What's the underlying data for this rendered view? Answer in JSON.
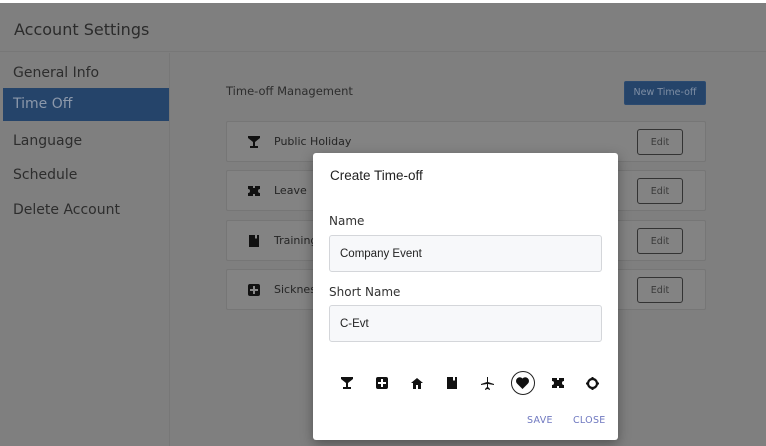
{
  "header": {
    "title": "Account Settings"
  },
  "sidebar": {
    "items": [
      {
        "label": "General Info"
      },
      {
        "label": "Time Off",
        "active": true
      },
      {
        "label": "Language"
      },
      {
        "label": "Schedule"
      },
      {
        "label": "Delete Account"
      }
    ]
  },
  "main": {
    "title": "Time-off Management",
    "new_button": "New Time-off",
    "edit_label": "Edit",
    "rows": [
      {
        "label": "Public Holiday",
        "icon": "cocktail-icon"
      },
      {
        "label": "Leave",
        "icon": "ticket-icon"
      },
      {
        "label": "Training",
        "icon": "book-icon"
      },
      {
        "label": "Sickness",
        "icon": "medical-plus-icon"
      }
    ]
  },
  "modal": {
    "title": "Create Time-off",
    "name_label": "Name",
    "name_value": "Company Event",
    "short_label": "Short Name",
    "short_value": "C-Evt",
    "icons": [
      "cocktail-icon",
      "medical-plus-icon",
      "home-icon",
      "book-icon",
      "airplane-icon",
      "heart-icon",
      "ticket-icon",
      "gear-icon"
    ],
    "selected_icon": "heart-icon",
    "save": "SAVE",
    "close": "CLOSE"
  },
  "colors": {
    "accent": "#25446a",
    "action": "#6f78c0"
  }
}
